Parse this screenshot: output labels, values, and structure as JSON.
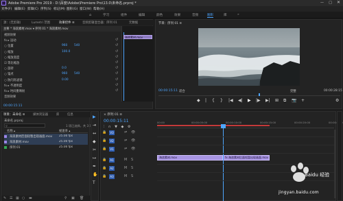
{
  "window": {
    "title": "Adobe Premiere Pro 2019 - D:\\百度\\Adobe\\Premiere Pro\\13.0\\未命名.prproj *",
    "min": "—",
    "max": "□",
    "close": "✕"
  },
  "menu": [
    "文件(F)",
    "编辑(E)",
    "剪辑(C)",
    "序列(S)",
    "标记(M)",
    "图形(G)",
    "窗口(W)",
    "帮助(H)"
  ],
  "workspaces": {
    "items": [
      "学习",
      "组件",
      "编辑",
      "颜色",
      "效果",
      "音频",
      "图形",
      "库"
    ],
    "active_index": 6,
    "more": "»"
  },
  "effect_controls": {
    "tabs": [
      "源：(无剪辑)",
      "Lumetri 范围",
      "效果控件 ≡",
      "音频剪辑混合器：序列 01",
      "元数据"
    ],
    "active_tab": 2,
    "clip_bar": "主要 * 海浪素材.mov ▾  序列 01 * 海浪素材.mov",
    "rows": [
      {
        "label": "视频效果",
        "v1": "",
        "v2": ""
      },
      {
        "label": "fx  ▸ 运动",
        "v1": "",
        "v2": ""
      },
      {
        "label": "    ○ 位置",
        "v1": "960",
        "v2": "540"
      },
      {
        "label": "    ○ 缩放",
        "v1": "100.0",
        "v2": ""
      },
      {
        "label": "    ○ 缩放宽度",
        "v1": "",
        "v2": ""
      },
      {
        "label": "       ☑ 等比缩放",
        "v1": "",
        "v2": ""
      },
      {
        "label": "    ○ 旋转",
        "v1": "0.0",
        "v2": ""
      },
      {
        "label": "    ○ 锚点",
        "v1": "960",
        "v2": "540"
      },
      {
        "label": "    ○ 防闪烁滤镜",
        "v1": "0.00",
        "v2": ""
      },
      {
        "label": "fx  ▸ 不透明度",
        "v1": "",
        "v2": ""
      },
      {
        "label": "fx  ▸ 时间重映射",
        "v1": "",
        "v2": ""
      },
      {
        "label": "音频效果",
        "v1": "",
        "v2": ""
      }
    ],
    "reset": "↺",
    "mini_clip": "海浪素材.mov",
    "timecode": "00:00:15:11"
  },
  "program": {
    "title": "节目：序列 01 ≡",
    "timecode": "00:00:15:11",
    "fit": "适合",
    "quality": "完整",
    "duration": "00:00:28:15",
    "transport": [
      "◆",
      "|",
      "{",
      "}",
      "|◀",
      "◀|",
      "▶",
      "|▶",
      "▶|",
      "⊞",
      "⧉",
      "📷",
      "+"
    ]
  },
  "project": {
    "tabs": [
      "项目：未命名 ≡",
      "媒体浏览器",
      "库",
      "信息"
    ],
    "name": "未命名.prproj",
    "count": "1 项已选择，共 3 项",
    "col_name": "名称 ▴",
    "col_rate": "帧速率 ▴",
    "rows": [
      {
        "name": "海浪素材后面短暂出现画面.mov",
        "rate": "25.00 fps",
        "color": "#9c86e8"
      },
      {
        "name": "海浪素材.mov",
        "rate": "25.00 fps",
        "color": "#9c86e8"
      },
      {
        "name": "序列 01",
        "rate": "25.00 fps",
        "color": "#34a853"
      }
    ],
    "footer": [
      "✎",
      "☰",
      "▦",
      "○",
      "▬",
      "⚲",
      "▣",
      "🗑"
    ]
  },
  "tools": [
    "▶",
    "⇥",
    "↔",
    "◆",
    "✂",
    "↦",
    "✒",
    "✋",
    "T"
  ],
  "timeline": {
    "title": "× 序列 01 ≡",
    "timecode": "00:00:15:11",
    "ticks": [
      "00:00",
      "00:00:05:00",
      "00:00:10:00",
      "00:00:15:00",
      "00:00:20:00",
      "00:00:25:00"
    ],
    "tracks": [
      "V3",
      "V2",
      "V1",
      "A1",
      "A2",
      "A3"
    ],
    "clips": [
      {
        "label": "海浪素材.mov"
      },
      {
        "label": "fx 海浪素材后面短暂出现画面.mov"
      }
    ]
  },
  "watermark": {
    "brand": "Baidu 经验",
    "url": "jingyan.baidu.com"
  }
}
